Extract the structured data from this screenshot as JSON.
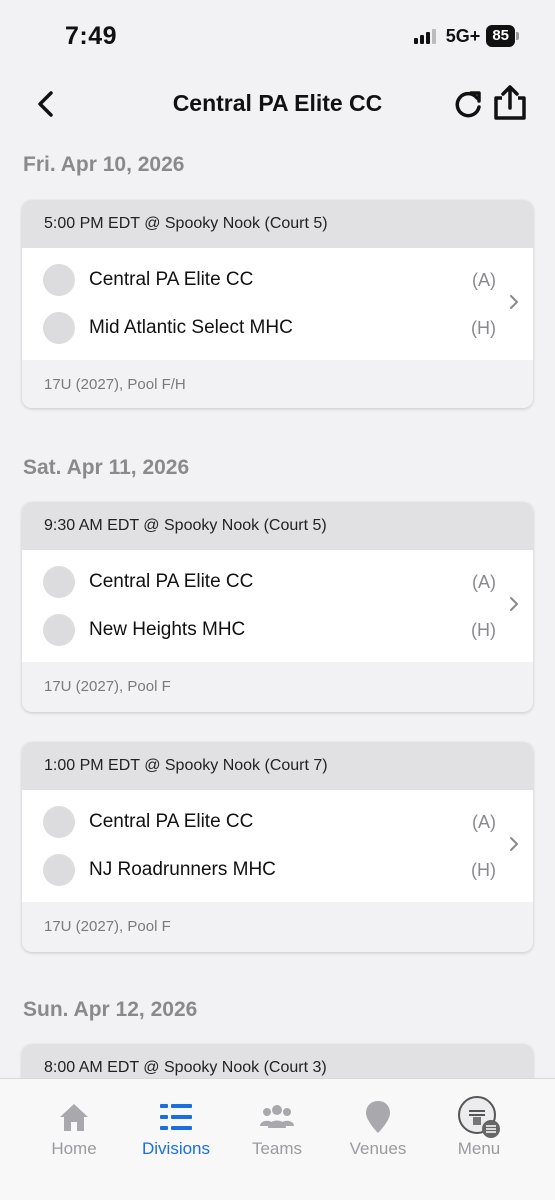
{
  "status_bar": {
    "time": "7:49",
    "network": "5G+",
    "battery": "85"
  },
  "header": {
    "title": "Central PA Elite CC"
  },
  "days": [
    {
      "date": "Fri. Apr 10, 2026"
    },
    {
      "date": "Sat. Apr 11, 2026"
    },
    {
      "date": "Sun. Apr 12, 2026"
    }
  ],
  "games": [
    {
      "time_venue": "5:00 PM EDT @ Spooky Nook (Court 5)",
      "team1": "Central PA Elite CC",
      "team1_side": "(A)",
      "team2": "Mid Atlantic Select MHC",
      "team2_side": "(H)",
      "division": "17U (2027), Pool F/H"
    },
    {
      "time_venue": "9:30 AM EDT @ Spooky Nook (Court 5)",
      "team1": "Central PA Elite CC",
      "team1_side": "(A)",
      "team2": "New Heights MHC",
      "team2_side": "(H)",
      "division": "17U (2027), Pool F"
    },
    {
      "time_venue": "1:00 PM EDT @ Spooky Nook (Court 7)",
      "team1": "Central PA Elite CC",
      "team1_side": "(A)",
      "team2": "NJ Roadrunners MHC",
      "team2_side": "(H)",
      "division": "17U (2027), Pool F"
    },
    {
      "time_venue": "8:00 AM EDT @ Spooky Nook (Court 3)"
    }
  ],
  "tabs": [
    {
      "label": "Home",
      "icon": "home-icon"
    },
    {
      "label": "Divisions",
      "icon": "divisions-icon"
    },
    {
      "label": "Teams",
      "icon": "teams-icon"
    },
    {
      "label": "Venues",
      "icon": "venue-pin-icon"
    },
    {
      "label": "Menu",
      "icon": "menu-logo-icon"
    }
  ],
  "colors": {
    "accent": "#1a6fe0",
    "inactive": "#9b9b9f",
    "date_heading": "#8a8a8e"
  }
}
